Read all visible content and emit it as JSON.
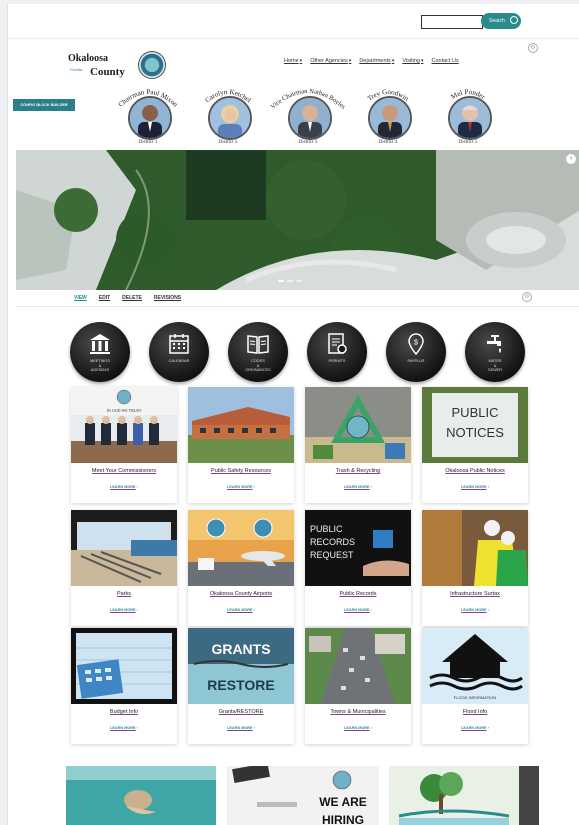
{
  "search": {
    "input_value": "",
    "button_label": "Search"
  },
  "logo": {
    "line1": "Okaloosa",
    "line2": "County",
    "sub": "Florida"
  },
  "nav": [
    {
      "label": "Home"
    },
    {
      "label": "Other Agencies"
    },
    {
      "label": "Departments"
    },
    {
      "label": "Visiting"
    },
    {
      "label": "Contact Us"
    }
  ],
  "config_button": "CONFIG BLOCK BUILDER",
  "commissioners": [
    {
      "name": "Chairman Paul Mixon",
      "district": "District 1"
    },
    {
      "name": "Carolyn Ketchel",
      "district": "District 2"
    },
    {
      "name": "Vice Chairman Nathan Boyles",
      "district": "District 3"
    },
    {
      "name": "Trey Goodwin",
      "district": "District 4"
    },
    {
      "name": "Mel Ponder",
      "district": "District 5"
    }
  ],
  "tabs": [
    {
      "label": "VIEW"
    },
    {
      "label": "EDIT"
    },
    {
      "label": "DELETE"
    },
    {
      "label": "REVISIONS"
    }
  ],
  "quick_links": [
    {
      "label": "MEETINGS\n&\nAGENDAS",
      "icon": "courthouse-icon"
    },
    {
      "label": "CALENDAR",
      "icon": "calendar-icon"
    },
    {
      "label": "CODES\n&\nORDINANCES",
      "icon": "book-icon"
    },
    {
      "label": "PERMITS",
      "icon": "permit-icon"
    },
    {
      "label": "PAYPLUS",
      "icon": "payment-icon"
    },
    {
      "label": "WATER\n&\nSEWER",
      "icon": "faucet-icon"
    }
  ],
  "cards": [
    {
      "title": "Meet Your Commissioners",
      "more": "LEARN MORE"
    },
    {
      "title": "Public Safety Resources",
      "more": "LEARN MORE"
    },
    {
      "title": "Trash & Recycling",
      "more": "LEARN MORE"
    },
    {
      "title": "Okaloosa Public Notices",
      "more": "LEARN MORE"
    },
    {
      "title": "Parks",
      "more": "LEARN MORE"
    },
    {
      "title": "Okaloosa County Airports",
      "more": "LEARN MORE"
    },
    {
      "title": "Public Records",
      "more": "LEARN MORE"
    },
    {
      "title": "Infrastructure Surtax",
      "more": "LEARN MORE"
    },
    {
      "title": "Budget Info",
      "more": "LEARN MORE"
    },
    {
      "title": "Grants/RESTORE",
      "more": "LEARN MORE"
    },
    {
      "title": "Towns & Municipalities",
      "more": "LEARN MORE"
    },
    {
      "title": "Flood Info",
      "more": "LEARN MORE"
    }
  ],
  "card_image_text": {
    "commissioners_banner": "IN GOD WE TRUST",
    "notices_line1": "PUBLIC",
    "notices_line2": "NOTICES",
    "records_line1": "PUBLIC",
    "records_line2": "RECORDS",
    "records_line3": "REQUEST",
    "grants_line1": "GRANTS",
    "grants_line2": "RESTORE",
    "flood_caption": "FLOOD INFORMATION"
  },
  "bottom": {
    "hiring_line1": "WE ARE",
    "hiring_line2": "HIRING"
  },
  "colors": {
    "accent": "#2a8c8a",
    "underline": "#8b3a9a",
    "button": "#2a7f8a"
  }
}
